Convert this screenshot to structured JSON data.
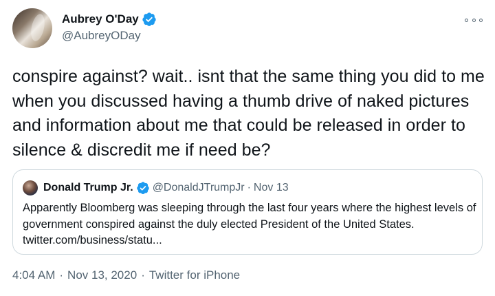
{
  "author": {
    "name": "Aubrey O'Day",
    "handle": "@AubreyODay"
  },
  "tweet_text": "conspire against? wait.. isnt that the same thing you did to me when you discussed having a thumb drive of naked pictures and information about me that could be released in order to silence & discredit me if need be?",
  "quoted_tweet": {
    "name": "Donald Trump Jr.",
    "handle": "@DonaldJTrumpJr",
    "separator": "·",
    "date": "Nov 13",
    "text": "Apparently Bloomberg was sleeping through the last four years where the highest levels of government conspired against the duly elected President of the United States. twitter.com/business/statu..."
  },
  "footer": {
    "time": "4:04 AM",
    "separator": "·",
    "date": "Nov 13, 2020",
    "source": "Twitter for iPhone"
  },
  "colors": {
    "verified": "#1d9bf0",
    "secondary_text": "#536471",
    "border": "#cfd9de"
  },
  "icons": {
    "verified": "verified-badge-icon",
    "more": "more-options-icon"
  }
}
